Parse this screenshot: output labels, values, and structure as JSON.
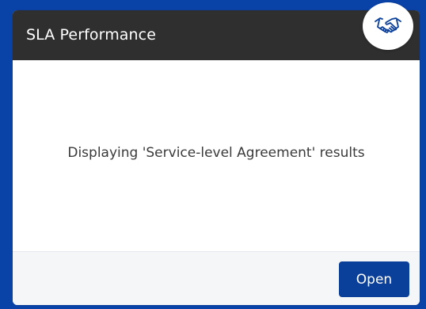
{
  "card": {
    "title": "SLA Performance",
    "message": "Displaying 'Service-level Agreement' results",
    "badge_icon": "handshake-icon",
    "open_label": "Open"
  },
  "colors": {
    "page_background": "#0a43a8",
    "header_background": "#2f2f2f",
    "button_background": "#0a3f9a",
    "footer_background": "#f5f6f8"
  }
}
